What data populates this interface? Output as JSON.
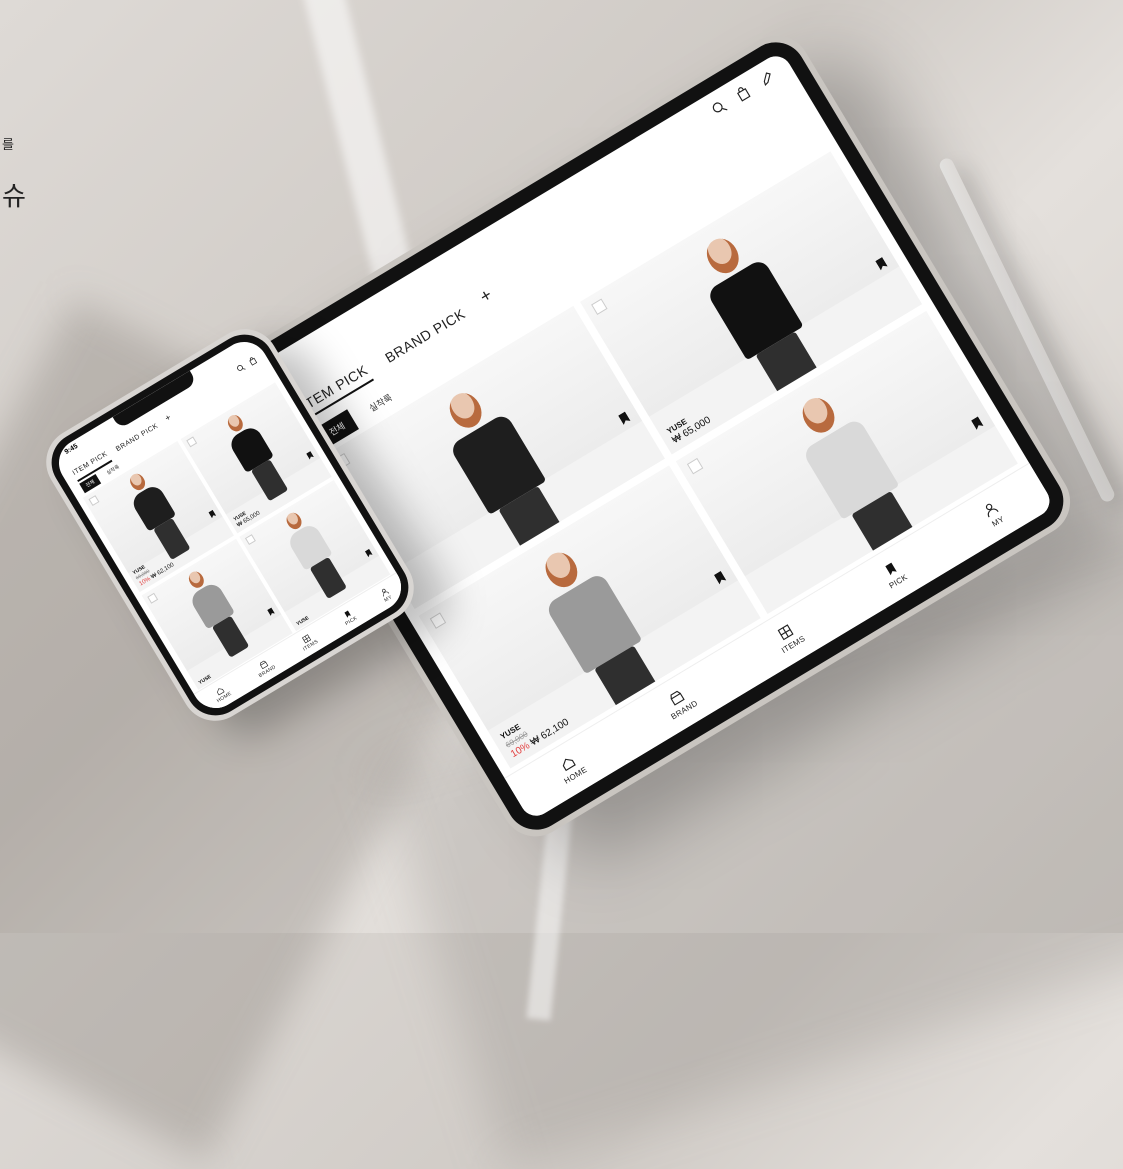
{
  "side_text": {
    "line1": "를",
    "line2": "슈"
  },
  "tablet": {
    "tabs": [
      {
        "label": "ITEM PICK",
        "active": true
      },
      {
        "label": "BRAND PICK",
        "active": false
      },
      {
        "label": "+",
        "active": false
      }
    ],
    "chips": [
      {
        "label": "전체",
        "active": true
      },
      {
        "label": "실착룩",
        "active": false
      }
    ],
    "products": [
      {
        "brand": "",
        "original_price": "",
        "discount": "",
        "price": "",
        "torso_color": "#1e1e1e"
      },
      {
        "brand": "YUSE",
        "original_price": "",
        "discount": "",
        "price": "₩ 65,000",
        "torso_color": "#111111"
      },
      {
        "brand": "YUSE",
        "original_price": "69,000",
        "discount": "10%",
        "price": "₩ 62,100",
        "torso_color": "#9a9a9a"
      },
      {
        "brand": "",
        "original_price": "",
        "discount": "",
        "price": "",
        "torso_color": "#d9d9d9"
      }
    ],
    "nav": [
      {
        "label": "HOME",
        "icon": "home-icon"
      },
      {
        "label": "BRAND",
        "icon": "store-icon"
      },
      {
        "label": "ITEMS",
        "icon": "grid-icon"
      },
      {
        "label": "PICK",
        "icon": "bookmark-icon"
      },
      {
        "label": "MY",
        "icon": "user-icon"
      }
    ]
  },
  "phone": {
    "time": "9:45",
    "tabs": [
      {
        "label": "ITEM PICK",
        "active": true
      },
      {
        "label": "BRAND PICK",
        "active": false
      },
      {
        "label": "+",
        "active": false
      }
    ],
    "chips": [
      {
        "label": "전체",
        "active": true
      },
      {
        "label": "실착룩",
        "active": false
      }
    ],
    "products": [
      {
        "brand": "YUSE",
        "original_price": "69,000",
        "discount": "10%",
        "price": "₩ 62,100",
        "torso_color": "#1e1e1e"
      },
      {
        "brand": "YUSE",
        "original_price": "",
        "discount": "",
        "price": "₩ 65,000",
        "torso_color": "#111111"
      },
      {
        "brand": "YUSE",
        "original_price": "",
        "discount": "",
        "price": "",
        "torso_color": "#9a9a9a"
      },
      {
        "brand": "YUSE",
        "original_price": "",
        "discount": "",
        "price": "",
        "torso_color": "#d9d9d9"
      }
    ],
    "nav": [
      {
        "label": "HOME",
        "icon": "home-icon"
      },
      {
        "label": "BRAND",
        "icon": "store-icon"
      },
      {
        "label": "ITEMS",
        "icon": "grid-icon"
      },
      {
        "label": "PICK",
        "icon": "bookmark-icon"
      },
      {
        "label": "MY",
        "icon": "user-icon"
      }
    ]
  },
  "colors": {
    "accent_discount": "#e23b3b",
    "active_chip": "#111111"
  }
}
